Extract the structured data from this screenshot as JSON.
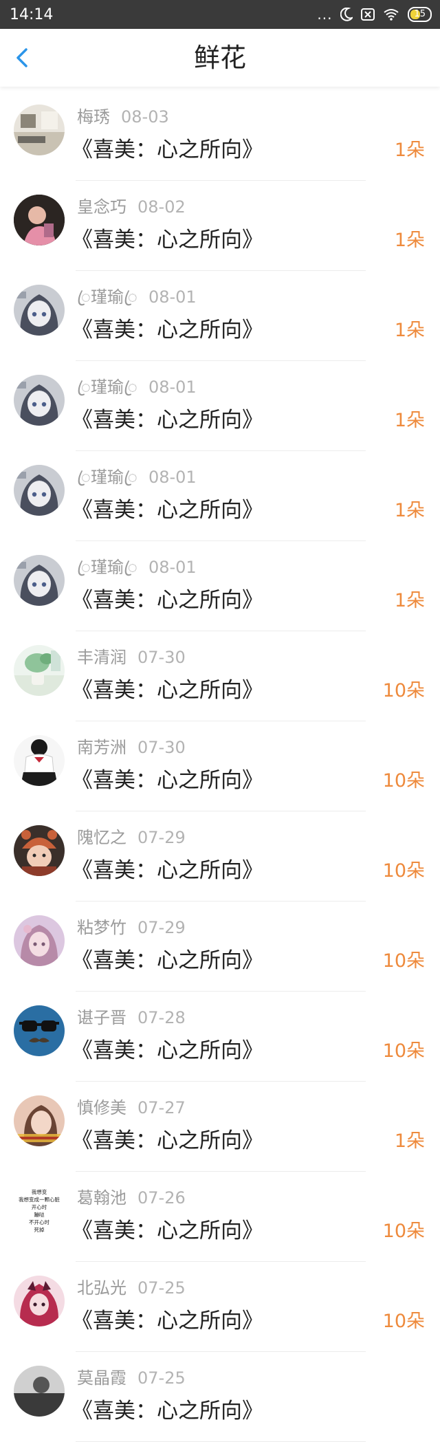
{
  "status_bar": {
    "time": "14:14",
    "dots": "...",
    "battery": "15"
  },
  "header": {
    "title": "鲜花"
  },
  "items": [
    {
      "name": "梅琇",
      "date": "08-03",
      "book": "《喜美：心之所向》",
      "count": "1朵",
      "avatar": "photo-room"
    },
    {
      "name": "皇念巧",
      "date": "08-02",
      "book": "《喜美：心之所向》",
      "count": "1朵",
      "avatar": "photo-child"
    },
    {
      "name": "ꦿ瑾瑜ꦿ",
      "date": "08-01",
      "book": "《喜美：心之所向》",
      "count": "1朵",
      "avatar": "anime-girl-gray"
    },
    {
      "name": "ꦿ瑾瑜ꦿ",
      "date": "08-01",
      "book": "《喜美：心之所向》",
      "count": "1朵",
      "avatar": "anime-girl-gray"
    },
    {
      "name": "ꦿ瑾瑜ꦿ",
      "date": "08-01",
      "book": "《喜美：心之所向》",
      "count": "1朵",
      "avatar": "anime-girl-gray"
    },
    {
      "name": "ꦿ瑾瑜ꦿ",
      "date": "08-01",
      "book": "《喜美：心之所向》",
      "count": "1朵",
      "avatar": "anime-girl-gray"
    },
    {
      "name": "丰清润",
      "date": "07-30",
      "book": "《喜美：心之所向》",
      "count": "10朵",
      "avatar": "photo-plant"
    },
    {
      "name": "南芳洲",
      "date": "07-30",
      "book": "《喜美：心之所向》",
      "count": "10朵",
      "avatar": "photo-uniform"
    },
    {
      "name": "隗忆之",
      "date": "07-29",
      "book": "《喜美：心之所向》",
      "count": "10朵",
      "avatar": "photo-baby-hat"
    },
    {
      "name": "粘梦竹",
      "date": "07-29",
      "book": "《喜美：心之所向》",
      "count": "10朵",
      "avatar": "photo-doll"
    },
    {
      "name": "谌子晋",
      "date": "07-28",
      "book": "《喜美：心之所向》",
      "count": "10朵",
      "avatar": "glasses-mustache"
    },
    {
      "name": "慎修美",
      "date": "07-27",
      "book": "《喜美：心之所向》",
      "count": "1朵",
      "avatar": "photo-girl-text"
    },
    {
      "name": "葛翰池",
      "date": "07-26",
      "book": "《喜美：心之所向》",
      "count": "10朵",
      "avatar": "text-image",
      "avatar_text": [
        "我想变",
        "我想变成一颗心脏",
        "开心时",
        "蹦哒",
        "不开心时",
        "死掉"
      ]
    },
    {
      "name": "北弘光",
      "date": "07-25",
      "book": "《喜美：心之所向》",
      "count": "10朵",
      "avatar": "anime-red"
    },
    {
      "name": "莫晶霞",
      "date": "07-25",
      "book": "《喜美：心之所向》",
      "count": "",
      "avatar": "photo-dark"
    }
  ],
  "colors": {
    "accent": "#ee8a3c",
    "back_arrow": "#2b95e9",
    "status_bar": "#3a3a3a"
  }
}
